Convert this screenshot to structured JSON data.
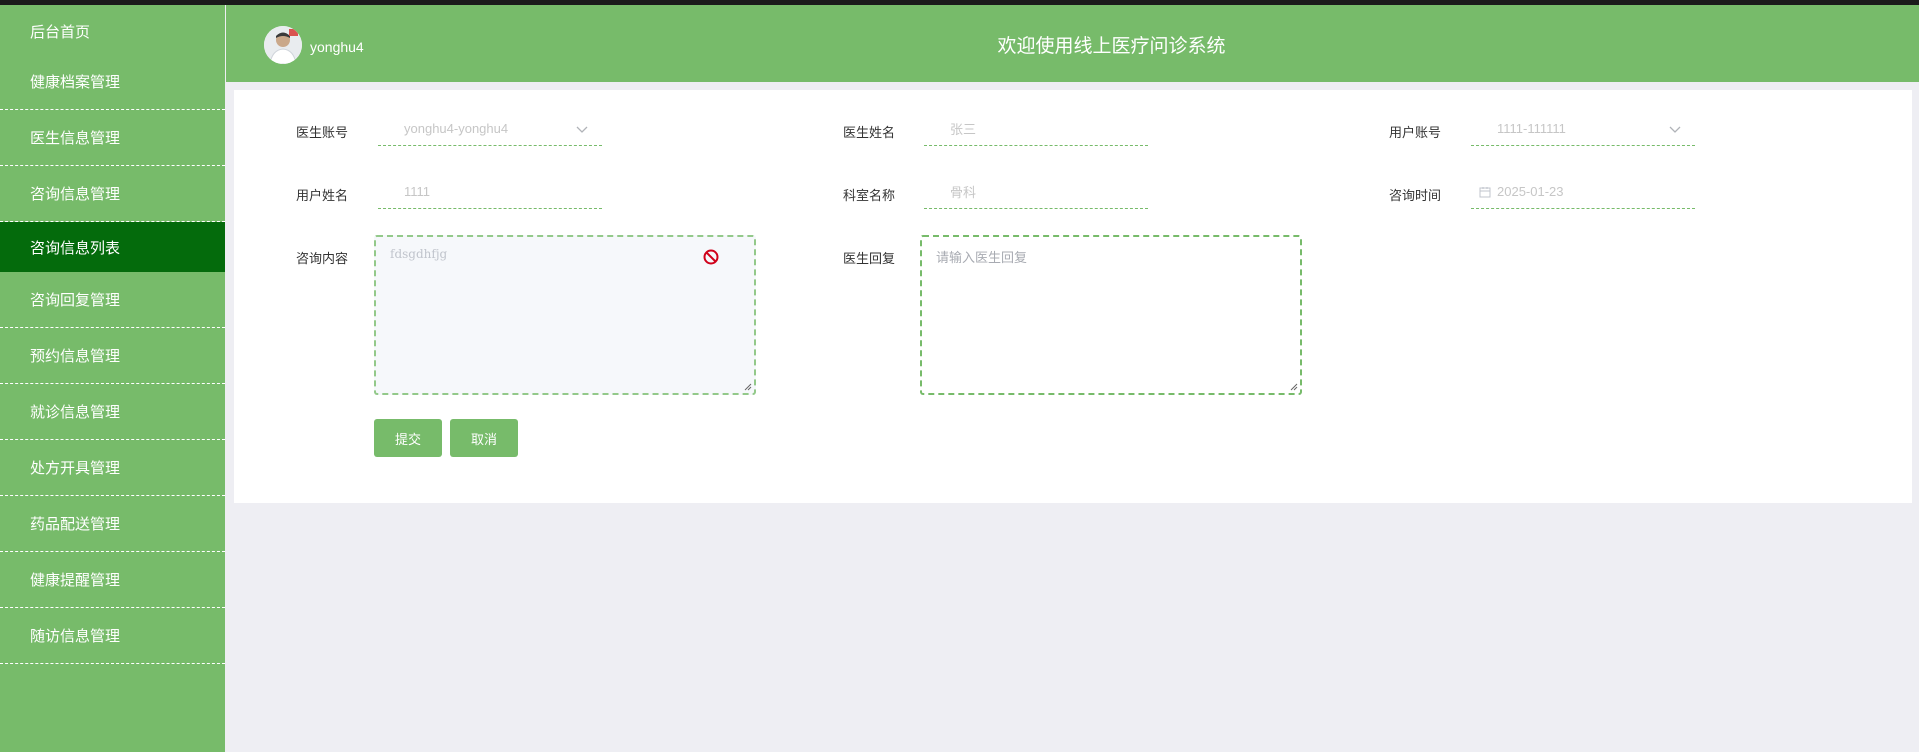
{
  "sidebar": {
    "items": [
      {
        "label": "后台首页"
      },
      {
        "label": "健康档案管理"
      },
      {
        "label": "医生信息管理"
      },
      {
        "label": "咨询信息管理"
      },
      {
        "label": "咨询信息列表"
      },
      {
        "label": "咨询回复管理"
      },
      {
        "label": "预约信息管理"
      },
      {
        "label": "就诊信息管理"
      },
      {
        "label": "处方开具管理"
      },
      {
        "label": "药品配送管理"
      },
      {
        "label": "健康提醒管理"
      },
      {
        "label": "随访信息管理"
      }
    ]
  },
  "header": {
    "username": "yonghu4",
    "title": "欢迎使用线上医疗问诊系统"
  },
  "form": {
    "doctor_account": {
      "label": "医生账号",
      "value": "yonghu4-yonghu4"
    },
    "doctor_name": {
      "label": "医生姓名",
      "value": "张三"
    },
    "user_account": {
      "label": "用户账号",
      "value": "1111-111111"
    },
    "user_name": {
      "label": "用户姓名",
      "value": "1111"
    },
    "department": {
      "label": "科室名称",
      "value": "骨科"
    },
    "consult_time": {
      "label": "咨询时间",
      "value": "2025-01-23"
    },
    "consult_content": {
      "label": "咨询内容",
      "value": "fdsgdhfjg"
    },
    "doctor_reply": {
      "label": "医生回复",
      "placeholder": "请输入医生回复"
    },
    "submit_label": "提交",
    "cancel_label": "取消"
  },
  "colors": {
    "accent": "#77bb6a",
    "active_menu": "#046b0c",
    "background": "#eeeef3"
  }
}
